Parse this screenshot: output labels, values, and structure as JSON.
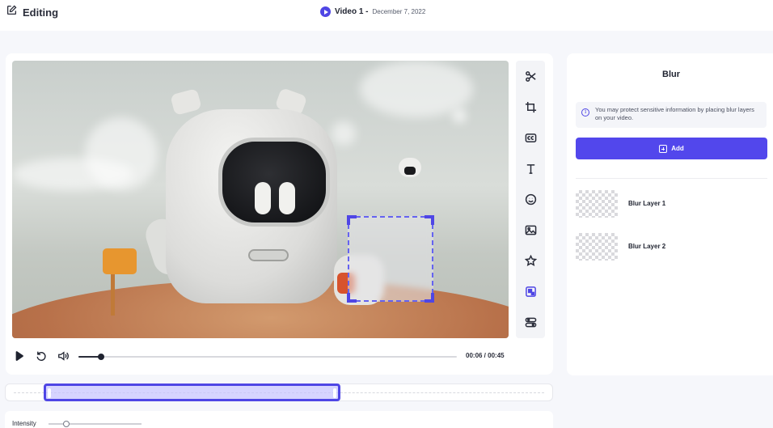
{
  "header": {
    "title": "Editing",
    "video_name": "Video 1 -",
    "video_date": "December 7, 2022"
  },
  "player": {
    "time_readout": "00:06 / 00:45",
    "progress": 0.06
  },
  "toolbar": {
    "tools": [
      {
        "name": "cut",
        "icon": "scissors-icon"
      },
      {
        "name": "crop",
        "icon": "crop-icon"
      },
      {
        "name": "captions",
        "icon": "cc-icon"
      },
      {
        "name": "text",
        "icon": "text-icon"
      },
      {
        "name": "emoji",
        "icon": "smiley-icon"
      },
      {
        "name": "image",
        "icon": "image-icon"
      },
      {
        "name": "sticker",
        "icon": "star-icon"
      },
      {
        "name": "blur",
        "icon": "blur-icon",
        "active": true
      },
      {
        "name": "filters",
        "icon": "adjust-icon"
      }
    ]
  },
  "timeline": {
    "selection_start": 0.07,
    "selection_end": 0.61
  },
  "intensity": {
    "label": "Intensity",
    "value": 0.19
  },
  "blur_panel": {
    "title": "Blur",
    "info": "You may protect sensitive information by placing blur layers on your video.",
    "add_label": "Add",
    "layers": [
      {
        "name": "Blur Layer 1"
      },
      {
        "name": "Blur Layer 2"
      }
    ]
  },
  "colors": {
    "accent": "#4f46e5",
    "add_button": "#5247ec",
    "background": "#f6f7fb"
  }
}
